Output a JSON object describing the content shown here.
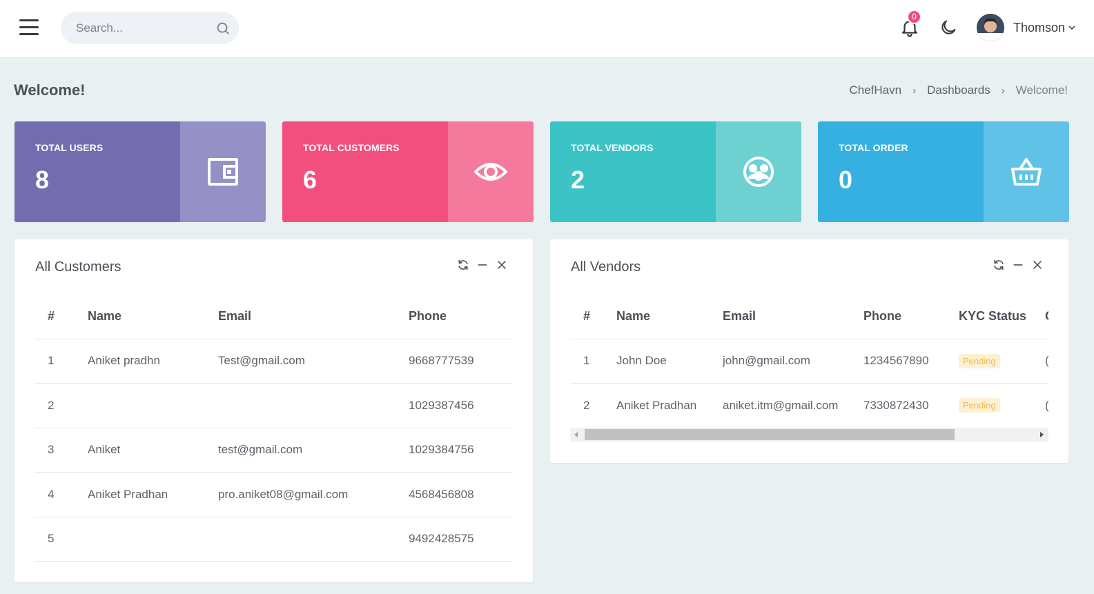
{
  "header": {
    "search_placeholder": "Search...",
    "notification_count": "0",
    "user_name": "Thomson"
  },
  "page": {
    "title": "Welcome!",
    "breadcrumb": [
      "ChefHavn",
      "Dashboards",
      "Welcome!"
    ]
  },
  "stats": [
    {
      "label": "TOTAL USERS",
      "value": "8",
      "color_main": "#736cae",
      "color_icon": "#9590c5",
      "icon": "wallet-icon"
    },
    {
      "label": "TOTAL CUSTOMERS",
      "value": "6",
      "color_main": "#f24e7e",
      "color_icon": "#f5799d",
      "icon": "eye-icon"
    },
    {
      "label": "TOTAL VENDORS",
      "value": "2",
      "color_main": "#3cc3c5",
      "color_icon": "#6dd1d2",
      "icon": "group-icon"
    },
    {
      "label": "TOTAL ORDER",
      "value": "0",
      "color_main": "#35b0e0",
      "color_icon": "#61c2e7",
      "icon": "basket-icon"
    }
  ],
  "customers": {
    "title": "All Customers",
    "columns": [
      "#",
      "Name",
      "Email",
      "Phone"
    ],
    "rows": [
      [
        "1",
        "Aniket pradhn",
        "Test@gmail.com",
        "9668777539"
      ],
      [
        "2",
        "",
        "",
        "1029387456"
      ],
      [
        "3",
        "Aniket",
        "test@gmail.com",
        "1029384756"
      ],
      [
        "4",
        "Aniket Pradhan",
        "pro.aniket08@gmail.com",
        "4568456808"
      ],
      [
        "5",
        "",
        "",
        "9492428575"
      ]
    ]
  },
  "vendors": {
    "title": "All Vendors",
    "columns": [
      "#",
      "Name",
      "Email",
      "Phone",
      "KYC Status",
      "C"
    ],
    "rows": [
      [
        "1",
        "John Doe",
        "john@gmail.com",
        "1234567890",
        "Pending",
        "("
      ],
      [
        "2",
        "Aniket Pradhan",
        "aniket.itm@gmail.com",
        "7330872430",
        "Pending",
        "("
      ]
    ]
  }
}
